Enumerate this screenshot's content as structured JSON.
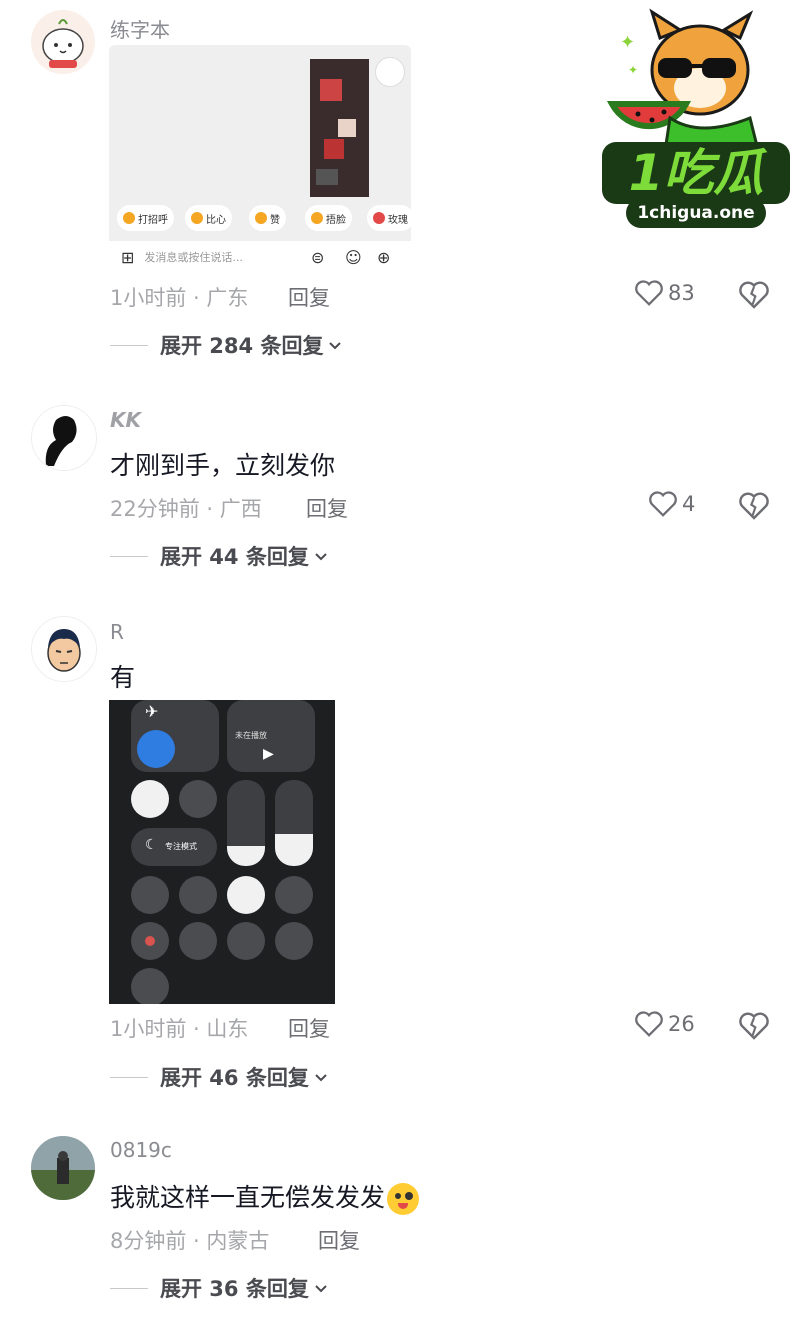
{
  "comments": [
    {
      "username": "练字本",
      "text": "",
      "image": {
        "quick_replies": [
          "打招呼",
          "比心",
          "赞",
          "捂脸",
          "玫瑰"
        ],
        "input_placeholder": "发消息或按住说话..."
      },
      "time_location": "1小时前 · 广东",
      "reply_label": "回复",
      "likes": "83",
      "expand_label": "展开 284 条回复"
    },
    {
      "username": "KK",
      "text": "才刚到手，立刻发你",
      "time_location": "22分钟前 · 广西",
      "reply_label": "回复",
      "likes": "4",
      "expand_label": "展开 44 条回复"
    },
    {
      "username": "R",
      "text": "有",
      "image": {
        "now_playing_label": "未在播放",
        "focus_mode_label": "专注模式"
      },
      "time_location": "1小时前 · 山东",
      "reply_label": "回复",
      "likes": "26",
      "expand_label": "展开 46 条回复"
    },
    {
      "username": "0819c",
      "text": "我就这样一直无偿发发发",
      "time_location": "8分钟前 · 内蒙古",
      "reply_label": "回复",
      "expand_label": "展开 36 条回复"
    }
  ],
  "watermark": {
    "big_text": "1吃瓜",
    "url_text": "1chigua.one"
  },
  "colors": {
    "meta_gray": "#a6a7ab",
    "text_dark": "#161823",
    "logo_green": "#3dbf2c",
    "logo_dark": "#1a3a16"
  }
}
